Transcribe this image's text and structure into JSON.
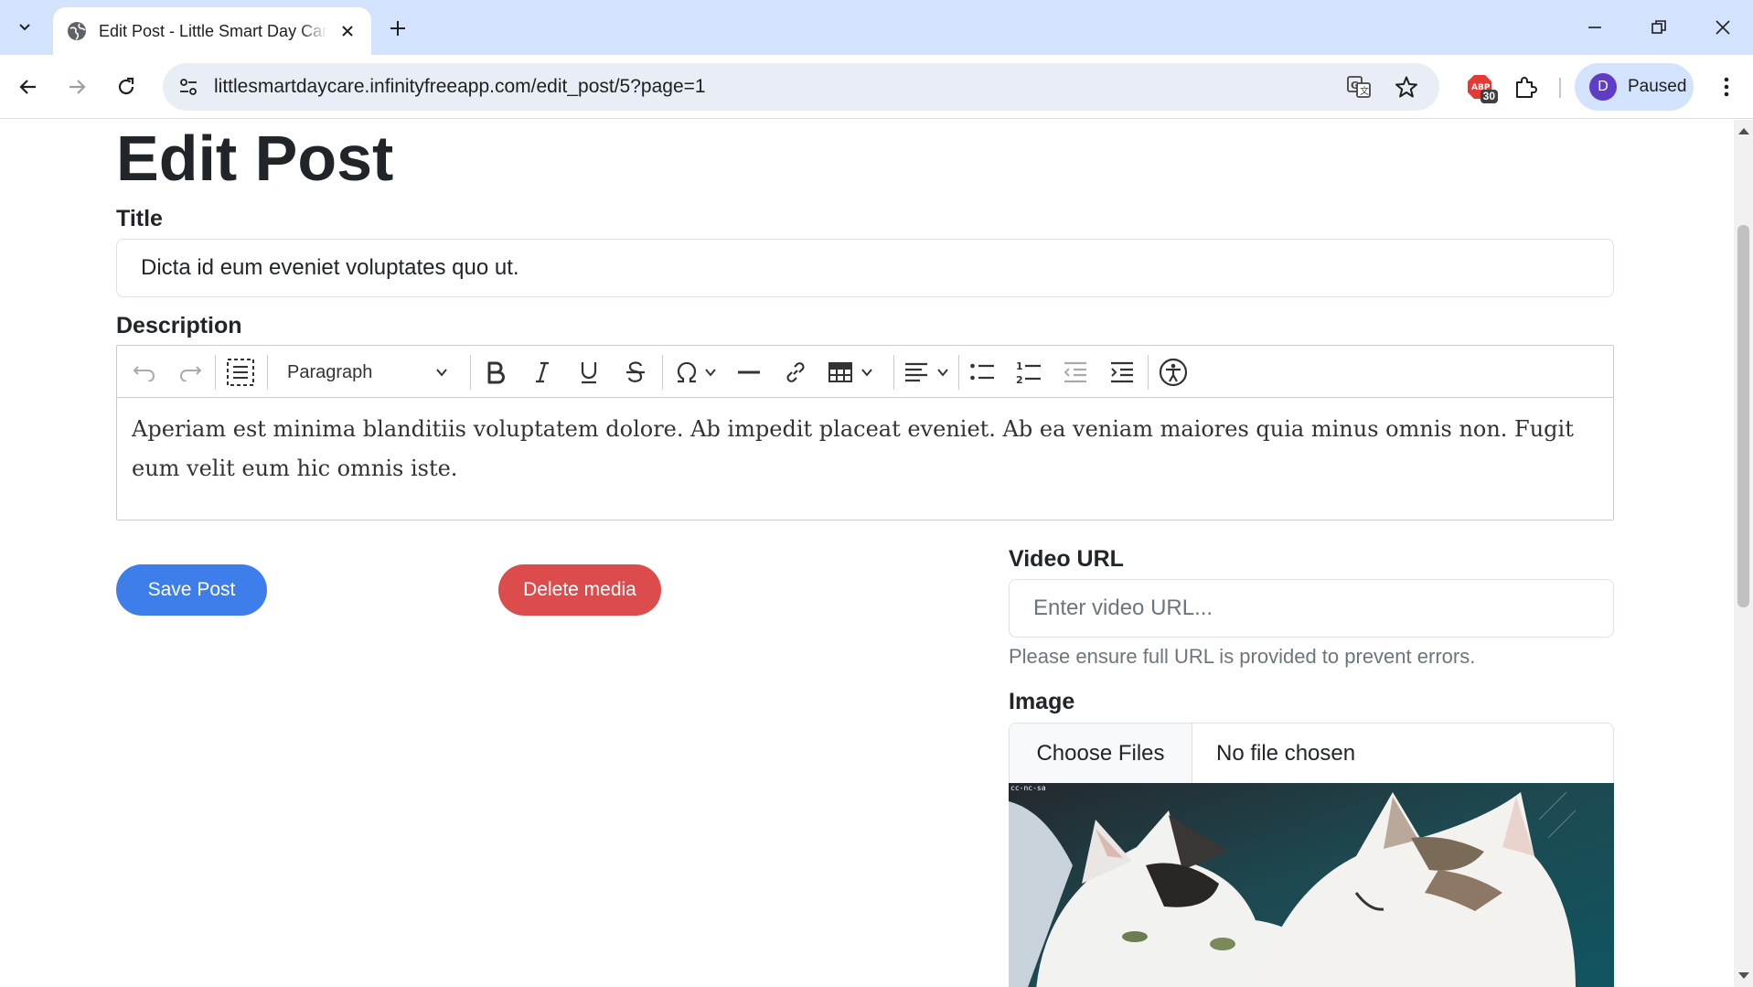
{
  "browser": {
    "tab_title": "Edit Post - Little Smart Day Care",
    "url": "littlesmartdaycare.infinityfreeapp.com/edit_post/5?page=1",
    "extension_badge": "30",
    "profile_initial": "D",
    "profile_status": "Paused"
  },
  "page": {
    "heading": "Edit Post",
    "title_label": "Title",
    "title_value": "Dicta id eum eveniet voluptates quo ut.",
    "description_label": "Description",
    "editor": {
      "block_format": "Paragraph",
      "content": "Aperiam est minima blanditiis voluptatem dolore. Ab impedit placeat eveniet. Ab ea veniam maiores quia minus omnis non. Fugit eum velit eum hic omnis iste."
    },
    "save_button": "Save Post",
    "delete_media_button": "Delete media",
    "video_url_label": "Video URL",
    "video_url_placeholder": "Enter video URL...",
    "video_url_help": "Please ensure full URL is provided to prevent errors.",
    "image_label": "Image",
    "choose_files_button": "Choose Files",
    "file_status": "No file chosen",
    "image_watermark": "cc-nc-sa"
  },
  "colors": {
    "primary": "#3d7eea",
    "danger": "#dc4c4c",
    "chrome_tab_strip": "#d3e3fd",
    "omnibox": "#e9eef6"
  }
}
